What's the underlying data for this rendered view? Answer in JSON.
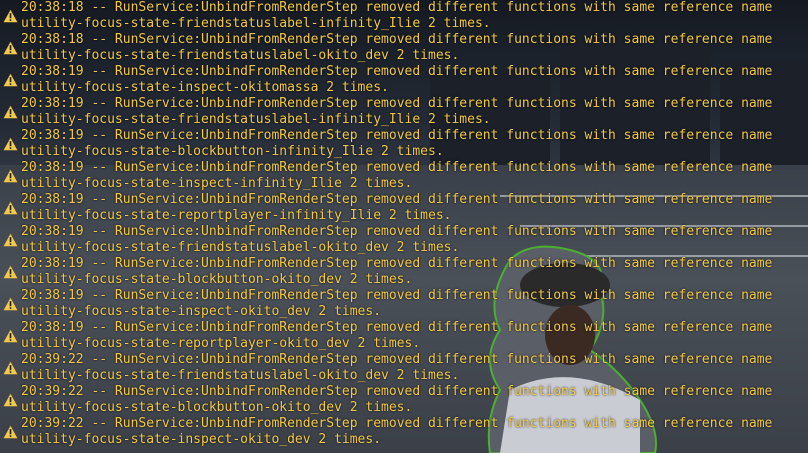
{
  "console": {
    "entries": [
      {
        "time": "20:38:18",
        "message": "-- RunService:UnbindFromRenderStep removed different functions with same reference name",
        "detail": "utility-focus-state-friendstatuslabel-infinity_Ilie 2 times."
      },
      {
        "time": "20:38:18",
        "message": "-- RunService:UnbindFromRenderStep removed different functions with same reference name",
        "detail": "utility-focus-state-friendstatuslabel-okito_dev 2 times."
      },
      {
        "time": "20:38:19",
        "message": "-- RunService:UnbindFromRenderStep removed different functions with same reference name",
        "detail": "utility-focus-state-inspect-okitomassa 2 times."
      },
      {
        "time": "20:38:19",
        "message": "-- RunService:UnbindFromRenderStep removed different functions with same reference name",
        "detail": "utility-focus-state-friendstatuslabel-infinity_Ilie 2 times."
      },
      {
        "time": "20:38:19",
        "message": "-- RunService:UnbindFromRenderStep removed different functions with same reference name",
        "detail": "utility-focus-state-blockbutton-infinity_Ilie 2 times."
      },
      {
        "time": "20:38:19",
        "message": "-- RunService:UnbindFromRenderStep removed different functions with same reference name",
        "detail": "utility-focus-state-inspect-infinity_Ilie 2 times."
      },
      {
        "time": "20:38:19",
        "message": "-- RunService:UnbindFromRenderStep removed different functions with same reference name",
        "detail": "utility-focus-state-reportplayer-infinity_Ilie 2 times."
      },
      {
        "time": "20:38:19",
        "message": "-- RunService:UnbindFromRenderStep removed different functions with same reference name",
        "detail": "utility-focus-state-friendstatuslabel-okito_dev 2 times."
      },
      {
        "time": "20:38:19",
        "message": "-- RunService:UnbindFromRenderStep removed different functions with same reference name",
        "detail": "utility-focus-state-blockbutton-okito_dev 2 times."
      },
      {
        "time": "20:38:19",
        "message": "-- RunService:UnbindFromRenderStep removed different functions with same reference name",
        "detail": "utility-focus-state-inspect-okito_dev 2 times."
      },
      {
        "time": "20:38:19",
        "message": "-- RunService:UnbindFromRenderStep removed different functions with same reference name",
        "detail": "utility-focus-state-reportplayer-okito_dev 2 times."
      },
      {
        "time": "20:39:22",
        "message": "-- RunService:UnbindFromRenderStep removed different functions with same reference name",
        "detail": "utility-focus-state-friendstatuslabel-okito_dev 2 times."
      },
      {
        "time": "20:39:22",
        "message": "-- RunService:UnbindFromRenderStep removed different functions with same reference name",
        "detail": "utility-focus-state-blockbutton-okito_dev 2 times."
      },
      {
        "time": "20:39:22",
        "message": "-- RunService:UnbindFromRenderStep removed different functions with same reference name",
        "detail": "utility-focus-state-inspect-okito_dev 2 times."
      }
    ]
  },
  "colors": {
    "warning_text": "#f2c94c",
    "warning_icon": "#f2c94c"
  },
  "icons": {
    "entry_icon": "warning-triangle-icon"
  }
}
